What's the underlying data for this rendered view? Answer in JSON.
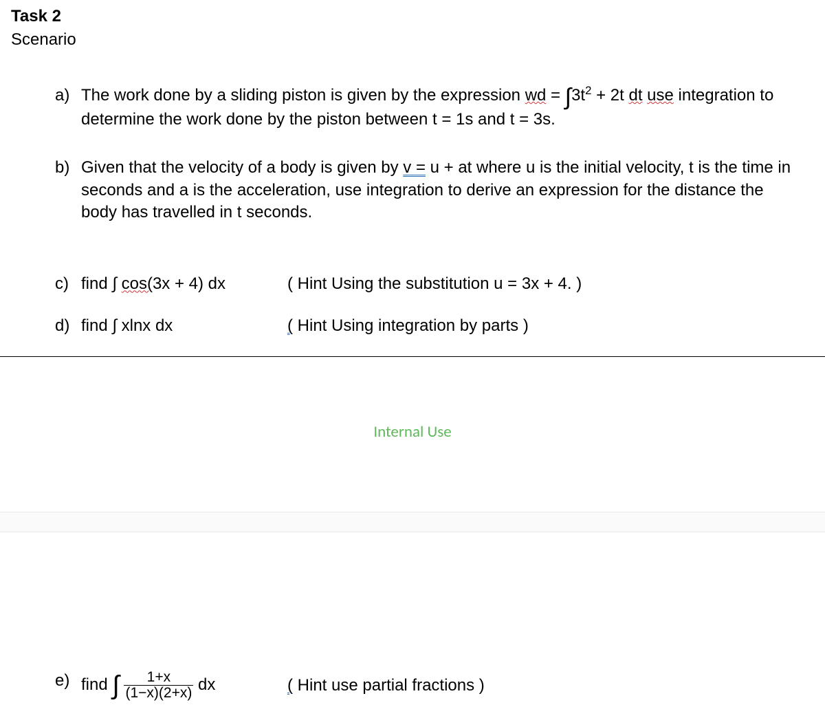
{
  "heading": "Task 2",
  "subheading": "Scenario",
  "internal_use": "Internal Use",
  "items": {
    "a": {
      "letter": "a)",
      "t1": "The work done by a sliding piston is given by the expression ",
      "wd": "wd",
      "eq": " = ",
      "int": "∫",
      "expr": "3t",
      "sup": "2",
      "expr2": " + 2t ",
      "dt": "dt",
      "sp": "  ",
      "use": "use",
      "t2": " integration to determine the work done by the piston between t = 1s and  t = 3s."
    },
    "b": {
      "letter": "b)",
      "t1": "Given that the velocity of a body is given by   ",
      "v": "v ",
      "eq": "=",
      "t2": "  u + at where u is the initial velocity, t is the time in seconds and a is the acceleration, use integration to derive an expression for the distance the body has travelled in t seconds."
    },
    "c": {
      "letter": "c)",
      "t1": "find ∫ ",
      "cos": "cos(",
      "t2": "3x + 4) dx",
      "hint": "( Hint Using the substitution u = 3x + 4. )"
    },
    "d": {
      "letter": "d)",
      "t1": "find ∫ xlnx dx",
      "pre": "  ",
      "paren": "(",
      "hint": " Hint Using integration by parts )"
    },
    "e": {
      "letter": "e)",
      "t1": "find ",
      "int": "∫",
      "num": "1+x",
      "den": "(1−x)(2+x)",
      "dx": " dx",
      "pre": "  ",
      "paren": "(",
      "hint": " Hint use partial fractions )"
    }
  }
}
